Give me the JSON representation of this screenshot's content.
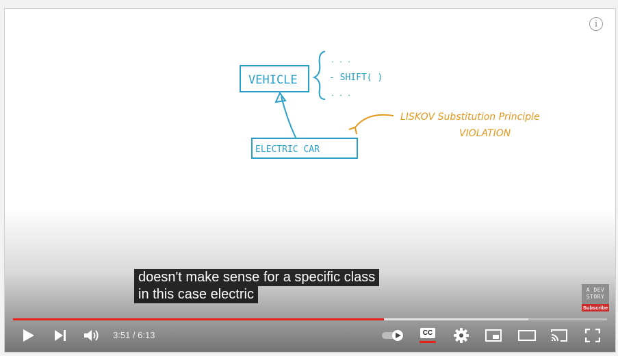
{
  "video": {
    "board_text": {
      "vehicle": "VEHICLE",
      "brace_top": ". . .",
      "shift": "- SHIFT( )",
      "brace_bottom": ". . .",
      "electric_car": "ELECTRIC CAR",
      "liskov_line1": "LISKOV Substitution Principle",
      "liskov_line2": "VIOLATION"
    },
    "ink_blue": "#2a9fc8",
    "ink_orange": "#e3981c"
  },
  "captions": {
    "line1": "doesn't make sense for a specific class",
    "line2": "in this case electric"
  },
  "watermark": {
    "line1": "A DEV",
    "line2": "STORY",
    "subscribe": "Subscribe"
  },
  "player": {
    "progress_played": 0.624,
    "progress_buffered": 0.868,
    "progress_color": "#e62117",
    "time_current": "3:51",
    "time_separator": " / ",
    "time_duration": "6:13",
    "info_glyph": "i",
    "cc_label": "CC"
  }
}
